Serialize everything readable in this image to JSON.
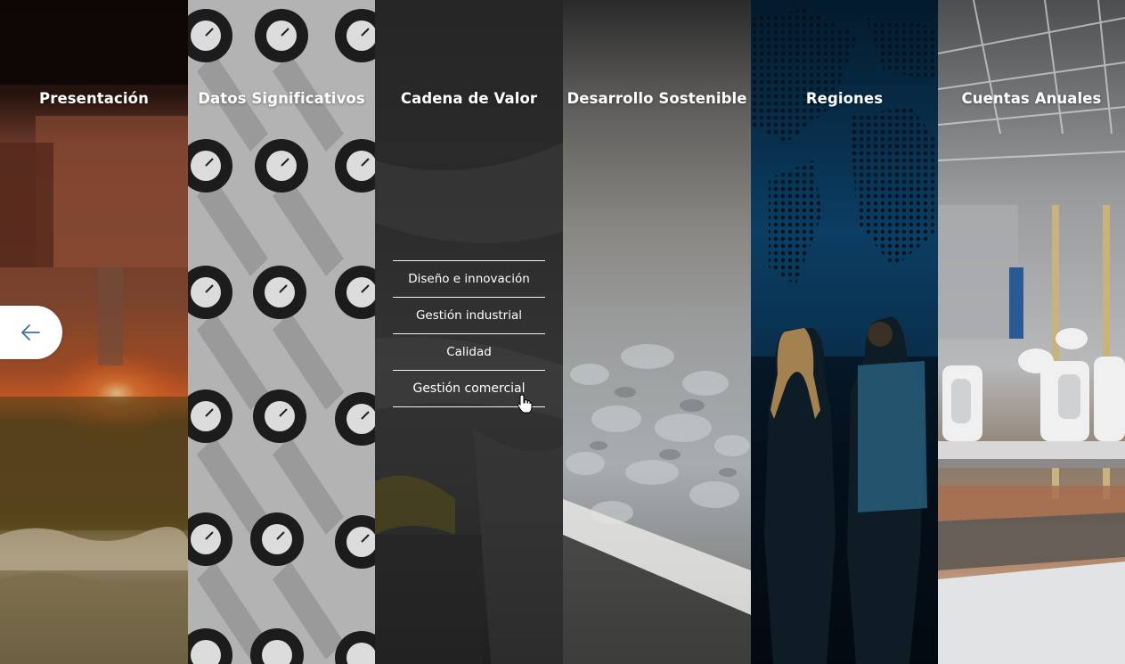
{
  "panels": [
    {
      "id": "presentacion",
      "title": "Presentación"
    },
    {
      "id": "datos",
      "title": "Datos Significativos"
    },
    {
      "id": "cadena",
      "title": "Cadena de Valor",
      "submenu": [
        {
          "label": "Diseño e innovación"
        },
        {
          "label": "Gestión industrial"
        },
        {
          "label": "Calidad"
        },
        {
          "label": "Gestión comercial"
        }
      ]
    },
    {
      "id": "desarrollo",
      "title": "Desarrollo Sostenible"
    },
    {
      "id": "regiones",
      "title": "Regiones"
    },
    {
      "id": "cuentas",
      "title": "Cuentas Anuales"
    }
  ],
  "icons": {
    "back": "arrow-left-icon",
    "cursor": "hand-pointer-icon"
  },
  "colors": {
    "accent": "#3d6fa3",
    "text": "#ffffff",
    "active_panel": "#2a2a2a"
  }
}
